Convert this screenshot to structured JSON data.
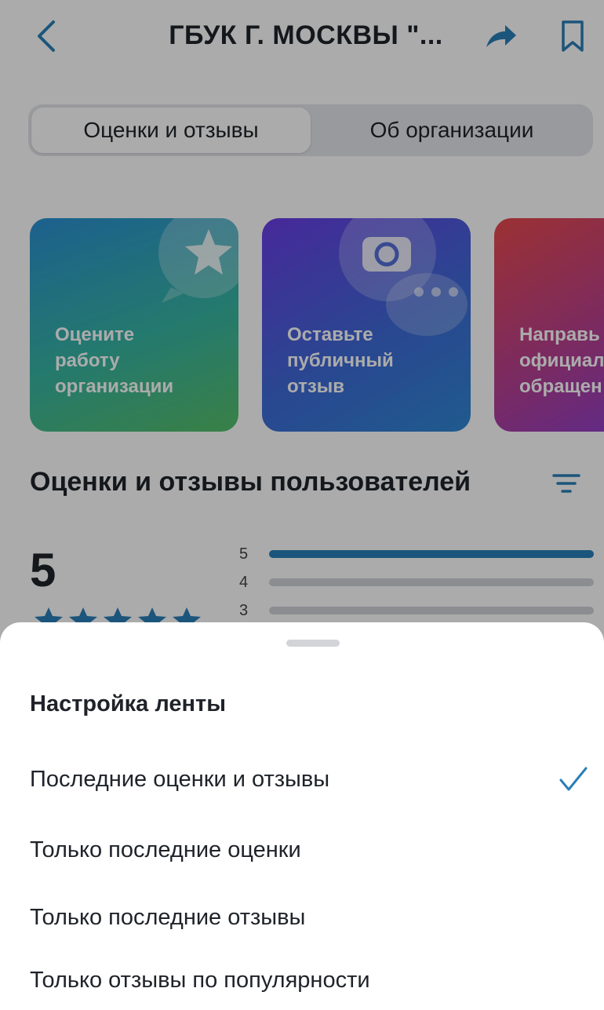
{
  "header": {
    "title": "ГБУК Г. МОСКВЫ \"...",
    "back_icon": "chevron-left-icon",
    "share_icon": "share-arrow-icon",
    "bookmark_icon": "bookmark-icon",
    "accent": "#2a7fb8"
  },
  "tabs": [
    {
      "label": "Оценки и отзывы",
      "active": true
    },
    {
      "label": "Об организации",
      "active": false
    }
  ],
  "cards": [
    {
      "lines": [
        "Оцените",
        "работу",
        "организации"
      ],
      "icon": "star-bubble-icon"
    },
    {
      "lines": [
        "Оставьте",
        "публичный",
        "отзыв"
      ],
      "icon": "camera-chat-icon"
    },
    {
      "lines": [
        "Направь",
        "официал",
        "обращен"
      ],
      "icon": "document-icon"
    }
  ],
  "ratings": {
    "section_title": "Оценки и отзывы пользователей",
    "filter_icon": "filter-icon",
    "average": "5",
    "stars": 5,
    "bars": [
      {
        "label": "5",
        "fraction": 1.0
      },
      {
        "label": "4",
        "fraction": 0.0
      },
      {
        "label": "3",
        "fraction": 0.0
      }
    ]
  },
  "sheet": {
    "title": "Настройка ленты",
    "options": [
      {
        "label": "Последние оценки и отзывы",
        "selected": true
      },
      {
        "label": "Только последние оценки",
        "selected": false
      },
      {
        "label": "Только последние отзывы",
        "selected": false
      },
      {
        "label": "Только отзывы по популярности",
        "selected": false
      }
    ],
    "check_icon": "checkmark-icon"
  }
}
